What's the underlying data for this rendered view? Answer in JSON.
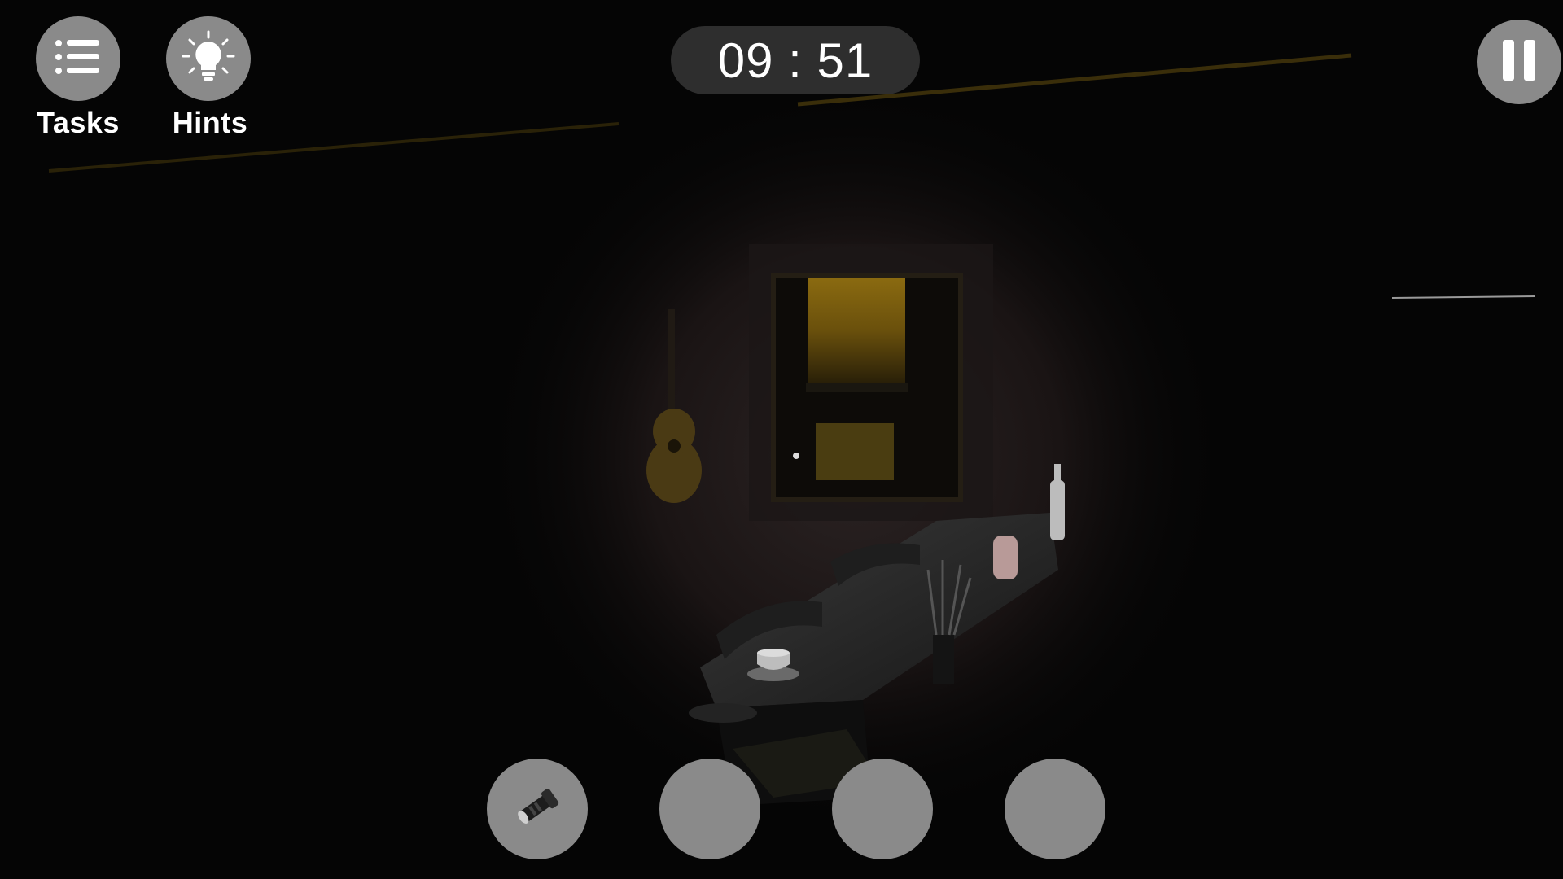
{
  "hud": {
    "tasks": {
      "label": "Tasks",
      "icon": "list-icon"
    },
    "hints": {
      "label": "Hints",
      "icon": "lightbulb-icon"
    },
    "timer": "09 : 51",
    "pause": {
      "icon": "pause-icon"
    }
  },
  "inventory": {
    "slots": [
      {
        "item": "flashlight-icon"
      },
      {
        "item": null
      },
      {
        "item": null
      },
      {
        "item": null
      }
    ]
  },
  "colors": {
    "button_fill": "#8a8a8a",
    "timer_fill": "#2e2e2e",
    "text": "#ffffff",
    "window_glow": "#c9a21a"
  }
}
